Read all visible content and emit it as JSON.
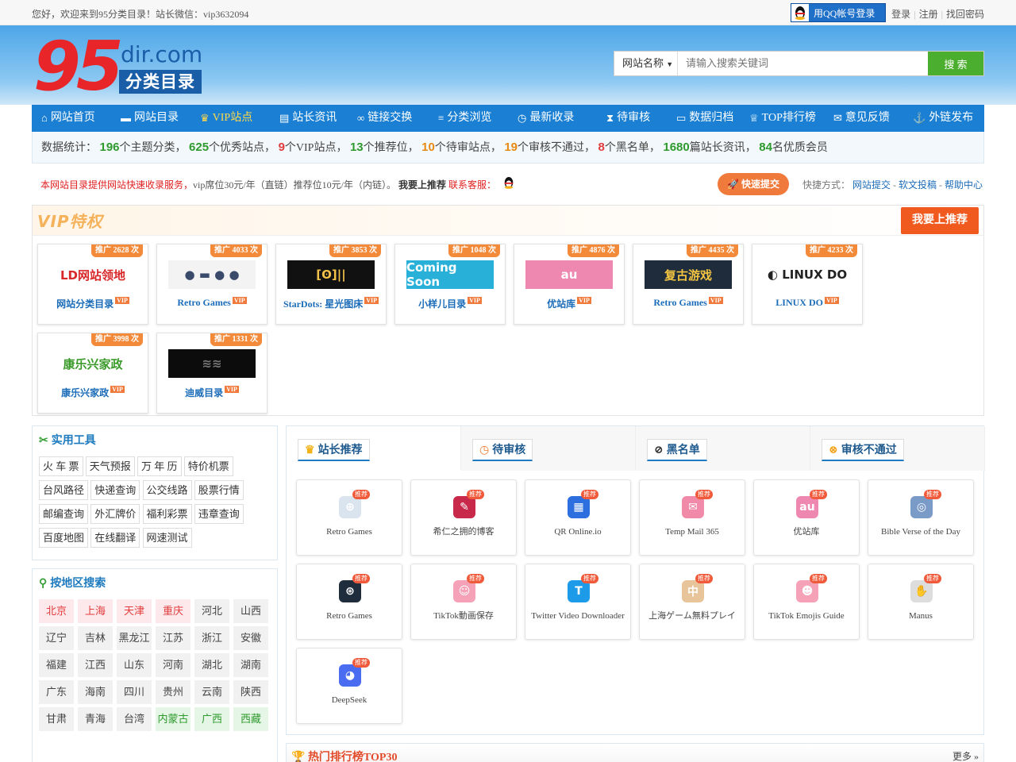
{
  "topbar": {
    "welcome": "您好，欢迎来到95分类目录！站长微信：vip3632094",
    "qq_login": "用QQ帐号登录",
    "links": [
      "登录",
      "注册",
      "找回密码"
    ]
  },
  "logo": {
    "num": "95",
    "dir": "dir.com",
    "cn": "分类目录"
  },
  "search": {
    "select": "网站名称",
    "placeholder": "请输入搜索关键词",
    "button": "搜 索"
  },
  "nav": [
    {
      "label": "网站首页",
      "icon": "home-icon",
      "glyph": "⌂",
      "w": 100
    },
    {
      "label": "网站目录",
      "icon": "folder-icon",
      "glyph": "▬",
      "w": 100
    },
    {
      "label": "VIP站点",
      "icon": "crown-icon",
      "glyph": "♛",
      "w": 100,
      "vip": true
    },
    {
      "label": "站长资讯",
      "icon": "news-icon",
      "glyph": "▤",
      "w": 98
    },
    {
      "label": "链接交换",
      "icon": "link-icon",
      "glyph": "∞",
      "w": 102
    },
    {
      "label": "分类浏览",
      "icon": "list-icon",
      "glyph": "≡",
      "w": 100
    },
    {
      "label": "最新收录",
      "icon": "clock-icon",
      "glyph": "◷",
      "w": 112
    },
    {
      "label": "待审核",
      "icon": "hourglass-icon",
      "glyph": "⧗",
      "w": 88
    },
    {
      "label": "数据归档",
      "icon": "archive-icon",
      "glyph": "▭",
      "w": 92
    },
    {
      "label": "TOP排行榜",
      "icon": "trophy-icon",
      "glyph": "♕",
      "w": 106
    },
    {
      "label": "意见反馈",
      "icon": "chat-icon",
      "glyph": "✉",
      "w": 100
    },
    {
      "label": "外链发布",
      "icon": "anchor-icon",
      "glyph": "⚓",
      "w": 102
    }
  ],
  "stats": {
    "prefix": "数据统计：",
    "items": [
      {
        "num": "196",
        "text": "个主题分类，",
        "c": "g"
      },
      {
        "num": "625",
        "text": "个优秀站点，",
        "c": "g"
      },
      {
        "num": "9",
        "text": "个VIP站点，",
        "c": "r"
      },
      {
        "num": "13",
        "text": "个推荐位，",
        "c": "g"
      },
      {
        "num": "10",
        "text": "个待审站点，",
        "c": "o"
      },
      {
        "num": "19",
        "text": "个审核不通过，",
        "c": "o"
      },
      {
        "num": "8",
        "text": "个黑名单，",
        "c": "r"
      },
      {
        "num": "1680",
        "text": "篇站长资讯，",
        "c": "g"
      },
      {
        "num": "84",
        "text": "名优质会员",
        "c": "g"
      }
    ]
  },
  "notice": {
    "red1": "本网站目录提供网站快速收录服务，",
    "gray1": "vip席位30元/年（直链）推荐位10元/年（内链）。",
    "bold": "我要上推荐",
    "red2": "联系客服：",
    "fast_btn": "快速提交",
    "quick_label": "快捷方式：",
    "quick_links": [
      "网站提交",
      "软文投稿",
      "帮助中心"
    ]
  },
  "vip": {
    "title": "VIP特权",
    "rec_button": "我要上推荐",
    "cards": [
      {
        "badge": "推广 2628 次",
        "name": "网站分类目录",
        "pic": "LD网站领地",
        "bg": "#ffffff",
        "fg": "#d8282a"
      },
      {
        "badge": "推广 4033 次",
        "name": "Retro Games",
        "pic": "● ▬ ● ●",
        "bg": "#f3f3f3",
        "fg": "#3a4a6a"
      },
      {
        "badge": "推广 3853 次",
        "name": "StarDots: 星光图床",
        "pic": "[ʘ]||",
        "bg": "#111111",
        "fg": "#f2c24a"
      },
      {
        "badge": "推广 1048 次",
        "name": "小样儿目录",
        "pic": "Coming Soon",
        "bg": "#29b0d8",
        "fg": "#ffffff"
      },
      {
        "badge": "推广 4876 次",
        "name": "优站库",
        "pic": "au",
        "bg": "#ee88b0",
        "fg": "#ffffff"
      },
      {
        "badge": "推广 4435 次",
        "name": "Retro Games",
        "pic": "复古游戏",
        "bg": "#1e2c3c",
        "fg": "#f5c542"
      },
      {
        "badge": "推广 4233 次",
        "name": "LINUX DO",
        "pic": "◐ LINUX DO",
        "bg": "#ffffff",
        "fg": "#222222"
      },
      {
        "badge": "推广 3998 次",
        "name": "康乐兴家政",
        "pic": "康乐兴家政",
        "bg": "#ffffff",
        "fg": "#3a9a2a"
      },
      {
        "badge": "推广 1331 次",
        "name": "迪威目录",
        "pic": "≋≋",
        "bg": "#0c0c0c",
        "fg": "#777777"
      }
    ]
  },
  "tools": {
    "title": "实用工具",
    "items": [
      "火 车 票",
      "天气预报",
      "万 年 历",
      "特价机票",
      "台风路径",
      "快递查询",
      "公交线路",
      "股票行情",
      "邮编查询",
      "外汇牌价",
      "福利彩票",
      "违章查询",
      "百度地图",
      "在线翻译",
      "网速测试"
    ]
  },
  "regions": {
    "title": "按地区搜索",
    "items": [
      {
        "n": "北京",
        "c": "pk"
      },
      {
        "n": "上海",
        "c": "pk"
      },
      {
        "n": "天津",
        "c": "pk"
      },
      {
        "n": "重庆",
        "c": "pk"
      },
      {
        "n": "河北",
        "c": ""
      },
      {
        "n": "山西",
        "c": ""
      },
      {
        "n": "辽宁",
        "c": ""
      },
      {
        "n": "吉林",
        "c": ""
      },
      {
        "n": "黑龙江",
        "c": ""
      },
      {
        "n": "江苏",
        "c": ""
      },
      {
        "n": "浙江",
        "c": ""
      },
      {
        "n": "安徽",
        "c": ""
      },
      {
        "n": "福建",
        "c": ""
      },
      {
        "n": "江西",
        "c": ""
      },
      {
        "n": "山东",
        "c": ""
      },
      {
        "n": "河南",
        "c": ""
      },
      {
        "n": "湖北",
        "c": ""
      },
      {
        "n": "湖南",
        "c": ""
      },
      {
        "n": "广东",
        "c": ""
      },
      {
        "n": "海南",
        "c": ""
      },
      {
        "n": "四川",
        "c": ""
      },
      {
        "n": "贵州",
        "c": ""
      },
      {
        "n": "云南",
        "c": ""
      },
      {
        "n": "陕西",
        "c": ""
      },
      {
        "n": "甘肃",
        "c": ""
      },
      {
        "n": "青海",
        "c": ""
      },
      {
        "n": "台湾",
        "c": ""
      },
      {
        "n": "内蒙古",
        "c": "gn"
      },
      {
        "n": "广西",
        "c": "gn"
      },
      {
        "n": "西藏",
        "c": "gn"
      }
    ]
  },
  "tabs": [
    {
      "label": "站长推荐",
      "glyph": "♛",
      "color": "#f2b21a",
      "active": true
    },
    {
      "label": "待审核",
      "glyph": "◷",
      "color": "#f07a2a"
    },
    {
      "label": "黑名单",
      "glyph": "⊘",
      "color": "#333333"
    },
    {
      "label": "审核不通过",
      "glyph": "⊗",
      "color": "#f2a21a"
    }
  ],
  "recommend": {
    "badge": "推荐",
    "items": [
      {
        "name": "Retro Games",
        "glyph": "⊕",
        "bg": "#d9e4ee"
      },
      {
        "name": "希仁之拥的博客",
        "glyph": "✎",
        "bg": "#c8284a"
      },
      {
        "name": "QR Online.io",
        "glyph": "▦",
        "bg": "#2e6fe0"
      },
      {
        "name": "Temp Mail 365",
        "glyph": "✉",
        "bg": "#f08aa8"
      },
      {
        "name": "优站库",
        "glyph": "au",
        "bg": "#ee88b0"
      },
      {
        "name": "Bible Verse of the Day",
        "glyph": "◎",
        "bg": "#7a9ac8"
      },
      {
        "name": "Retro Games",
        "glyph": "⊛",
        "bg": "#1e2c3c"
      },
      {
        "name": "TikTok動画保存",
        "glyph": "☺",
        "bg": "#f5a2b8"
      },
      {
        "name": "Twitter Video Downloader",
        "glyph": "T",
        "bg": "#1e9be8"
      },
      {
        "name": "上海ゲーム無料プレイ",
        "glyph": "中",
        "bg": "#e8c49a"
      },
      {
        "name": "TikTok Emojis Guide",
        "glyph": "☻",
        "bg": "#f5a2b8"
      },
      {
        "name": "Manus",
        "glyph": "✋",
        "bg": "#dddddd"
      },
      {
        "name": "DeepSeek",
        "glyph": "◕",
        "bg": "#4a6cf0"
      }
    ]
  },
  "hot": {
    "title": "热门排行榜TOP30",
    "more": "更多 »"
  }
}
